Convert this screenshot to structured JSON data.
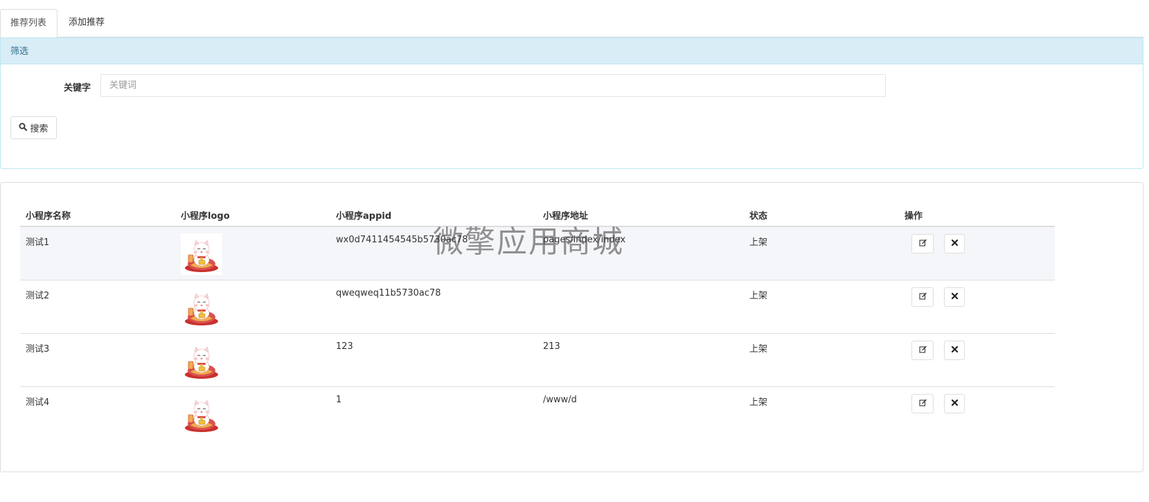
{
  "tabs": [
    {
      "label": "推荐列表"
    },
    {
      "label": "添加推荐"
    }
  ],
  "filter": {
    "heading": "筛选",
    "keyword_label": "关键字",
    "keyword_placeholder": "关键词",
    "keyword_value": "",
    "search_label": "搜索"
  },
  "table": {
    "headers": [
      "小程序名称",
      "小程序logo",
      "小程序appid",
      "小程序地址",
      "状态",
      "操作"
    ],
    "rows": [
      {
        "name": "测试1",
        "appid": "wx0d7411454545b5730ac78",
        "address": "pages/index/index",
        "status": "上架"
      },
      {
        "name": "测试2",
        "appid": "qweqweq11b5730ac78",
        "address": "",
        "status": "上架"
      },
      {
        "name": "测试3",
        "appid": "123",
        "address": "213",
        "status": "上架"
      },
      {
        "name": "测试4",
        "appid": "1",
        "address": "/www/d",
        "status": "上架"
      }
    ]
  },
  "watermark": "微擎应用商城",
  "icons": {
    "search": "search-icon",
    "edit": "edit-icon",
    "delete": "close-icon",
    "logo": "lucky-cat-logo"
  }
}
